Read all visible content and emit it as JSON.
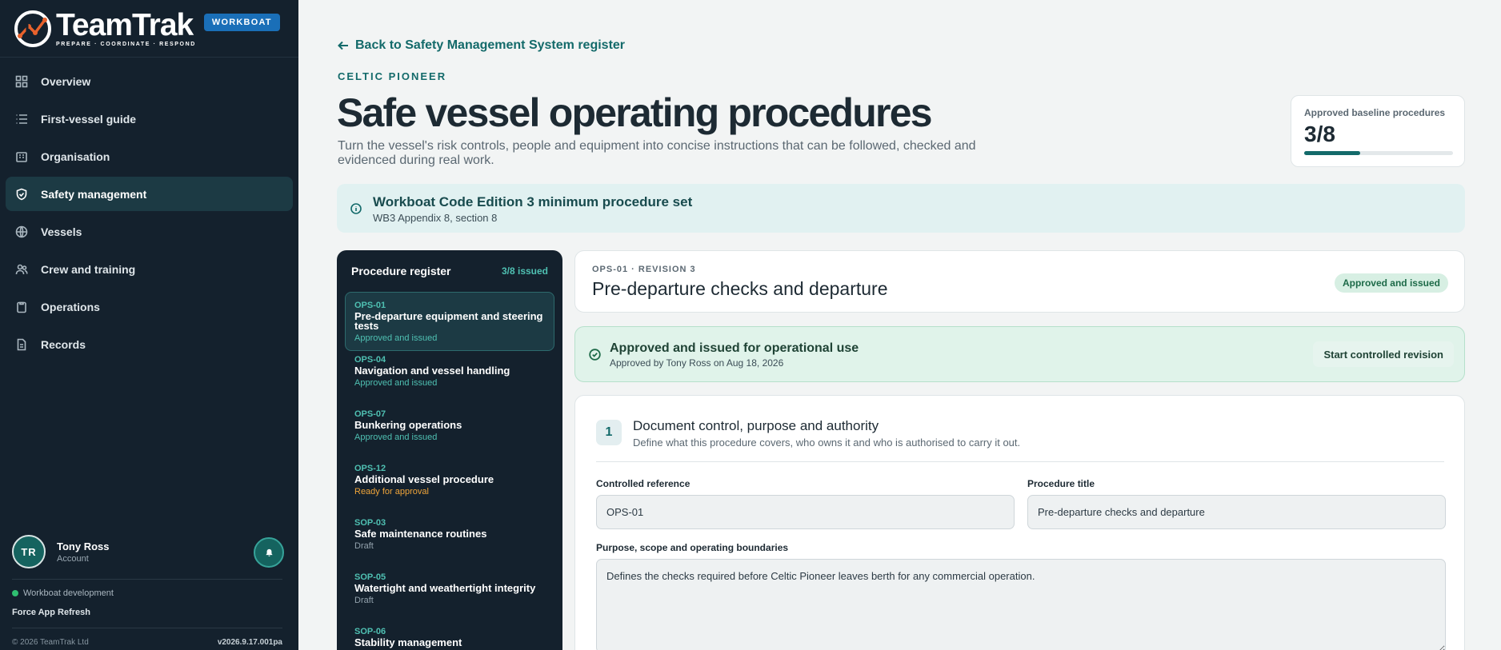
{
  "brand": {
    "name": "TeamTrak",
    "tagline": "PREPARE · COORDINATE · RESPOND",
    "badge": "WORKBOAT"
  },
  "sidebar": {
    "items": [
      {
        "label": "Overview",
        "icon": "grid-icon"
      },
      {
        "label": "First-vessel guide",
        "icon": "list-icon"
      },
      {
        "label": "Organisation",
        "icon": "building-icon"
      },
      {
        "label": "Safety management",
        "icon": "shield-icon",
        "active": true
      },
      {
        "label": "Vessels",
        "icon": "globe-icon"
      },
      {
        "label": "Crew and training",
        "icon": "people-icon"
      },
      {
        "label": "Operations",
        "icon": "clipboard-icon"
      },
      {
        "label": "Records",
        "icon": "document-icon"
      }
    ],
    "user": {
      "initials": "TR",
      "name": "Tony Ross",
      "role": "Account"
    },
    "environment": "Workboat development",
    "refresh_label": "Force App Refresh",
    "copyright": "© 2026 TeamTrak Ltd",
    "version": "v2026.9.17.001pa"
  },
  "header": {
    "back_label": "Back to Safety Management System register",
    "vessel": "CELTIC PIONEER",
    "title": "Safe vessel operating procedures",
    "description": "Turn the vessel's risk controls, people and equipment into concise instructions that can be followed, checked and evidenced during real work."
  },
  "progress": {
    "label": "Approved baseline procedures",
    "value_text": "3/8",
    "fraction": 0.375
  },
  "info": {
    "title": "Workboat Code Edition 3 minimum procedure set",
    "subtitle": "WB3 Appendix 8, section 8"
  },
  "register": {
    "title": "Procedure register",
    "count": "3/8 issued",
    "items": [
      {
        "code": "OPS-01",
        "name": "Pre-departure equipment and steering tests",
        "status": "Approved and issued",
        "kind": "approved",
        "active": true
      },
      {
        "code": "OPS-04",
        "name": "Navigation and vessel handling",
        "status": "Approved and issued",
        "kind": "approved"
      },
      {
        "code": "OPS-07",
        "name": "Bunkering operations",
        "status": "Approved and issued",
        "kind": "approved"
      },
      {
        "code": "OPS-12",
        "name": "Additional vessel procedure",
        "status": "Ready for approval",
        "kind": "ready"
      },
      {
        "code": "SOP-03",
        "name": "Safe maintenance routines",
        "status": "Draft",
        "kind": "draft"
      },
      {
        "code": "SOP-05",
        "name": "Watertight and weathertight integrity",
        "status": "Draft",
        "kind": "draft"
      },
      {
        "code": "SOP-06",
        "name": "Stability management",
        "status": "",
        "kind": "draft"
      }
    ]
  },
  "document": {
    "kicker": "OPS-01 · REVISION 3",
    "title": "Pre-departure checks and departure",
    "status_pill": "Approved and issued"
  },
  "approval": {
    "title": "Approved and issued for operational use",
    "subtitle": "Approved by Tony Ross on Aug 18, 2026",
    "button": "Start controlled revision"
  },
  "section": {
    "number": "1",
    "title": "Document control, purpose and authority",
    "subtitle": "Define what this procedure covers, who owns it and who is authorised to carry it out.",
    "fields": {
      "reference_label": "Controlled reference",
      "reference_value": "OPS-01",
      "title_label": "Procedure title",
      "title_value": "Pre-departure checks and departure",
      "purpose_label": "Purpose, scope and operating boundaries",
      "purpose_value": "Defines the checks required before Celtic Pioneer leaves berth for any commercial operation."
    }
  },
  "colors": {
    "sidebar_bg": "#14212d",
    "accent_teal": "#136a6a",
    "brand_badge": "#1a6fb8",
    "approved_green": "#d7efe3",
    "ready_orange": "#f0a53a"
  }
}
